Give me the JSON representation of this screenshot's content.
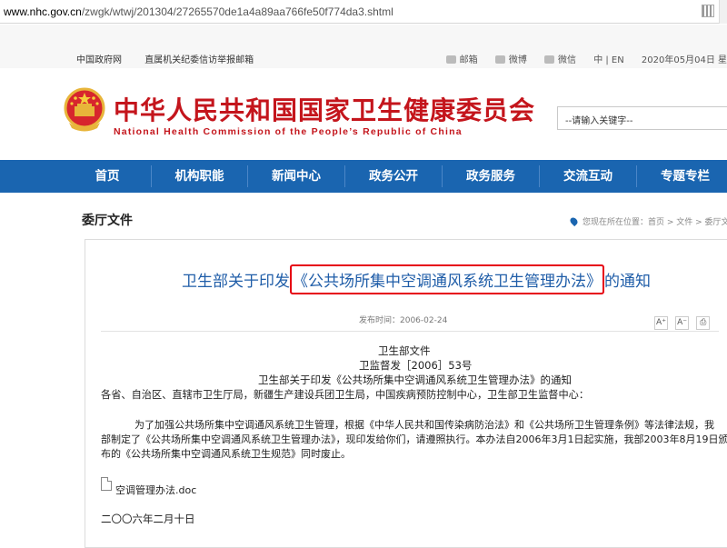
{
  "browser": {
    "url_domain": "www.nhc.gov.cn",
    "url_path": "/zwgk/wtwj/201304/27265570de1a4a89aa766fe50f774da3.shtml"
  },
  "util": {
    "left_links": [
      "中国政府网",
      "直属机关纪委信访举报邮箱"
    ],
    "mail": "邮箱",
    "weibo": "微博",
    "wechat": "微信",
    "lang": "中 | EN",
    "date": "2020年05月04日 星"
  },
  "header": {
    "title_cn": "中华人民共和国国家卫生健康委员会",
    "title_en": "National Health Commission of the People’s Republic of China",
    "search_placeholder": "--请输入关键字--"
  },
  "nav": {
    "items": [
      "首页",
      "机构职能",
      "新闻中心",
      "政务公开",
      "政务服务",
      "交流互动",
      "专题专栏"
    ]
  },
  "section": {
    "title": "委厅文件",
    "breadcrumb": "您现在所在位置：首页 > 文件 > 委厅文件"
  },
  "article": {
    "title_pre": "卫生部关于印发",
    "title_highlight": "《公共场所集中空调通风系统卫生管理办法》",
    "title_post": "的通知",
    "publish": "发布时间：2006-02-24",
    "tool_font_up": "A⁺",
    "tool_font_down": "A⁻",
    "line1": "卫生部文件",
    "line2": "卫监督发［2006］53号",
    "line3": "卫生部关于印发《公共场所集中空调通风系统卫生管理办法》的通知",
    "line4": "各省、自治区、直辖市卫生厅局，新疆生产建设兵团卫生局，中国疾病预防控制中心，卫生部卫生监督中心：",
    "p1": "为了加强公共场所集中空调通风系统卫生管理，根据《中华人民共和国传染病防治法》和《公共场所卫生管理条例》等法律法规，我",
    "p2": "部制定了《公共场所集中空调通风系统卫生管理办法》，现印发给你们，请遵照执行。本办法自2006年3月1日起实施，我部2003年8月19日颁",
    "p3": "布的《公共场所集中空调通风系统卫生规范》同时废止。",
    "attachment": "空调管理办法.doc",
    "date": "二〇〇六年二月十日"
  }
}
